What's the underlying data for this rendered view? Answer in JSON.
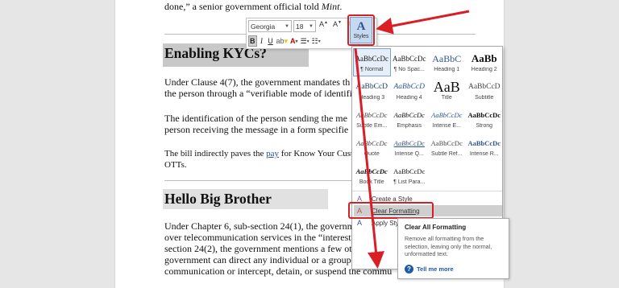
{
  "document": {
    "top_line_start": "done,",
    "top_line_rest": "” a senior government official told ",
    "top_line_italic": "Mint",
    "top_line_end": ".",
    "heading1": "Enabling KYCs?",
    "para1_line1": "Under Clause 4(7), the government mandates th",
    "para1_line2": "the person through a “verifiable mode of identifi",
    "para2_line1": "The identification of the person sending the me",
    "para2_line2": "person receiving the message in a form specifie",
    "para3_line1_a": "The bill indirectly paves the ",
    "para3_line1_link": "pay",
    "para3_line1_b": " for Know Your Custom",
    "para3_line2": "OTTs.",
    "heading2": "Hello Big Brother",
    "para4_line1": "Under Chapter 6, sub-section 24(1), the governm",
    "para4_line2": "over telecommunication services in the “interest of public s",
    "para4_line3": "section 24(2), the government mentions a few other instanc",
    "para4_line4": "government can direct any individual or a group to stop the",
    "para4_line5": "communication or intercept, detain, or suspend the commu"
  },
  "mini_toolbar": {
    "font_name": "Georgia",
    "font_size": "18",
    "bold": "B",
    "italic": "I",
    "underline": "U",
    "styles_label": "Styles"
  },
  "styles_gallery": {
    "items": [
      {
        "sample": "AaBbCcDc",
        "name": "¶ Normal"
      },
      {
        "sample": "AaBbCcDc",
        "name": "¶ No Spac..."
      },
      {
        "sample": "AaBbC",
        "name": "Heading 1"
      },
      {
        "sample": "AaBb",
        "name": "Heading 2"
      },
      {
        "sample": "AaBbCcD",
        "name": "Heading 3"
      },
      {
        "sample": "AaBbCcD",
        "name": "Heading 4"
      },
      {
        "sample": "AaB",
        "name": "Title"
      },
      {
        "sample": "AaBbCcD",
        "name": "Subtitle"
      },
      {
        "sample": "AaBbCcDc",
        "name": "Subtle Em..."
      },
      {
        "sample": "AaBbCcDc",
        "name": "Emphasis"
      },
      {
        "sample": "AaBbCcDc",
        "name": "Intense E..."
      },
      {
        "sample": "AaBbCcDc",
        "name": "Strong"
      },
      {
        "sample": "AaBbCcDc",
        "name": "Quote"
      },
      {
        "sample": "AaBbCcDc",
        "name": "Intense Q..."
      },
      {
        "sample": "AaBbCcDc",
        "name": "Subtle Ref..."
      },
      {
        "sample": "AaBbCcDc",
        "name": "Intense R..."
      },
      {
        "sample": "AaBbCcDc",
        "name": "Book Title"
      },
      {
        "sample": "AaBbCcDc",
        "name": "¶ List Para..."
      }
    ],
    "create_style": "Create a Style",
    "clear_formatting": "Clear Formatting",
    "apply_styles": "Apply Styles..."
  },
  "tooltip": {
    "title": "Clear All Formatting",
    "description": "Remove all formatting from the selection, leaving only the normal, unformatted text.",
    "tell_me_more": "Tell me more"
  },
  "colors": {
    "annotation_red": "#d91e26",
    "heading_highlight": "#c8c8c8",
    "styles_button": "#c5d9f1",
    "link_blue": "#1e5aa8"
  }
}
